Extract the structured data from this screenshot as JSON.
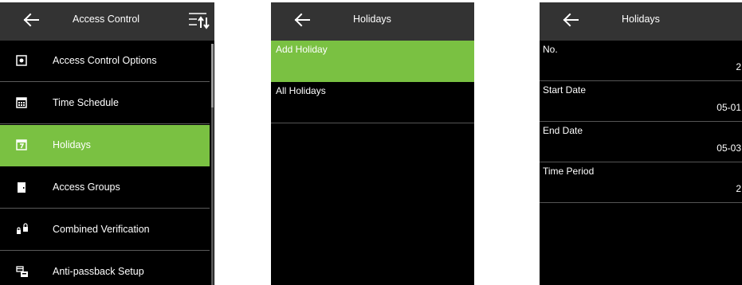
{
  "screen1": {
    "title": "Access Control",
    "menu": [
      {
        "label": "Access Control Options",
        "icon": "access-options-icon"
      },
      {
        "label": "Time Schedule",
        "icon": "calendar-icon"
      },
      {
        "label": "Holidays",
        "icon": "holiday-calendar-icon"
      },
      {
        "label": "Access Groups",
        "icon": "door-icon"
      },
      {
        "label": "Combined Verification",
        "icon": "locks-icon"
      },
      {
        "label": "Anti-passback Setup",
        "icon": "anti-passback-icon"
      }
    ]
  },
  "screen2": {
    "title": "Holidays",
    "items": [
      {
        "label": "Add Holiday"
      },
      {
        "label": "All Holidays"
      }
    ]
  },
  "screen3": {
    "title": "Holidays",
    "fields": [
      {
        "label": "No.",
        "value": "2"
      },
      {
        "label": "Start Date",
        "value": "05-01"
      },
      {
        "label": "End Date",
        "value": "05-03"
      },
      {
        "label": "Time Period",
        "value": "2"
      }
    ]
  },
  "colors": {
    "header_bg": "#333333",
    "screen_bg": "#000000",
    "highlight": "#7ac142"
  }
}
